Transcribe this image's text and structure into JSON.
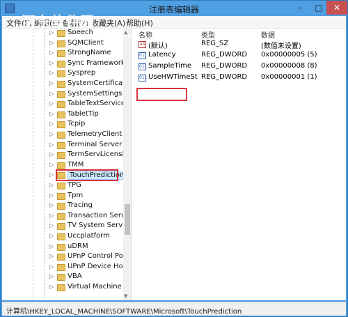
{
  "window": {
    "title": "注册表编辑器"
  },
  "watermark": {
    "text": "河东软件园",
    "url": "www.pc0359.cn"
  },
  "menu": [
    "文件(F)",
    "编辑(E)",
    "查看(V)",
    "收藏夹(A)",
    "帮助(H)"
  ],
  "tree": {
    "items": [
      "Speech",
      "SQMClient",
      "StrongName",
      "Sync Framework",
      "Sysprep",
      "SystemCertificates",
      "SystemSettings",
      "TableTextService",
      "TabletTip",
      "Tcpip",
      "TelemetryClient",
      "Terminal Server Clie",
      "TermServLicensing",
      "TMM",
      "TouchPrediction",
      "TPG",
      "Tpm",
      "Tracing",
      "Transaction Server",
      "TV System Services",
      "Uccplatform",
      "uDRM",
      "UPnP Control Point",
      "UPnP Device Host",
      "VBA",
      "Virtual Machine"
    ],
    "selected": "TouchPrediction"
  },
  "list": {
    "headers": {
      "name": "名称",
      "type": "类型",
      "data": "数据"
    },
    "rows": [
      {
        "icon": "ab",
        "name": "(默认)",
        "type": "REG_SZ",
        "data": "(数值未设置)"
      },
      {
        "icon": "011",
        "name": "Latency",
        "type": "REG_DWORD",
        "data": "0x00000005 (5)"
      },
      {
        "icon": "011",
        "name": "SampleTime",
        "type": "REG_DWORD",
        "data": "0x00000008 (8)"
      },
      {
        "icon": "011",
        "name": "UseHWTimeSt...",
        "type": "REG_DWORD",
        "data": "0x00000001 (1)"
      }
    ]
  },
  "status": {
    "path": "计算机\\HKEY_LOCAL_MACHINE\\SOFTWARE\\Microsoft\\TouchPrediction"
  },
  "colors": {
    "titlebar": "#4fa0e3",
    "selection": "#cce8ff",
    "highlight": "#d9333b"
  }
}
